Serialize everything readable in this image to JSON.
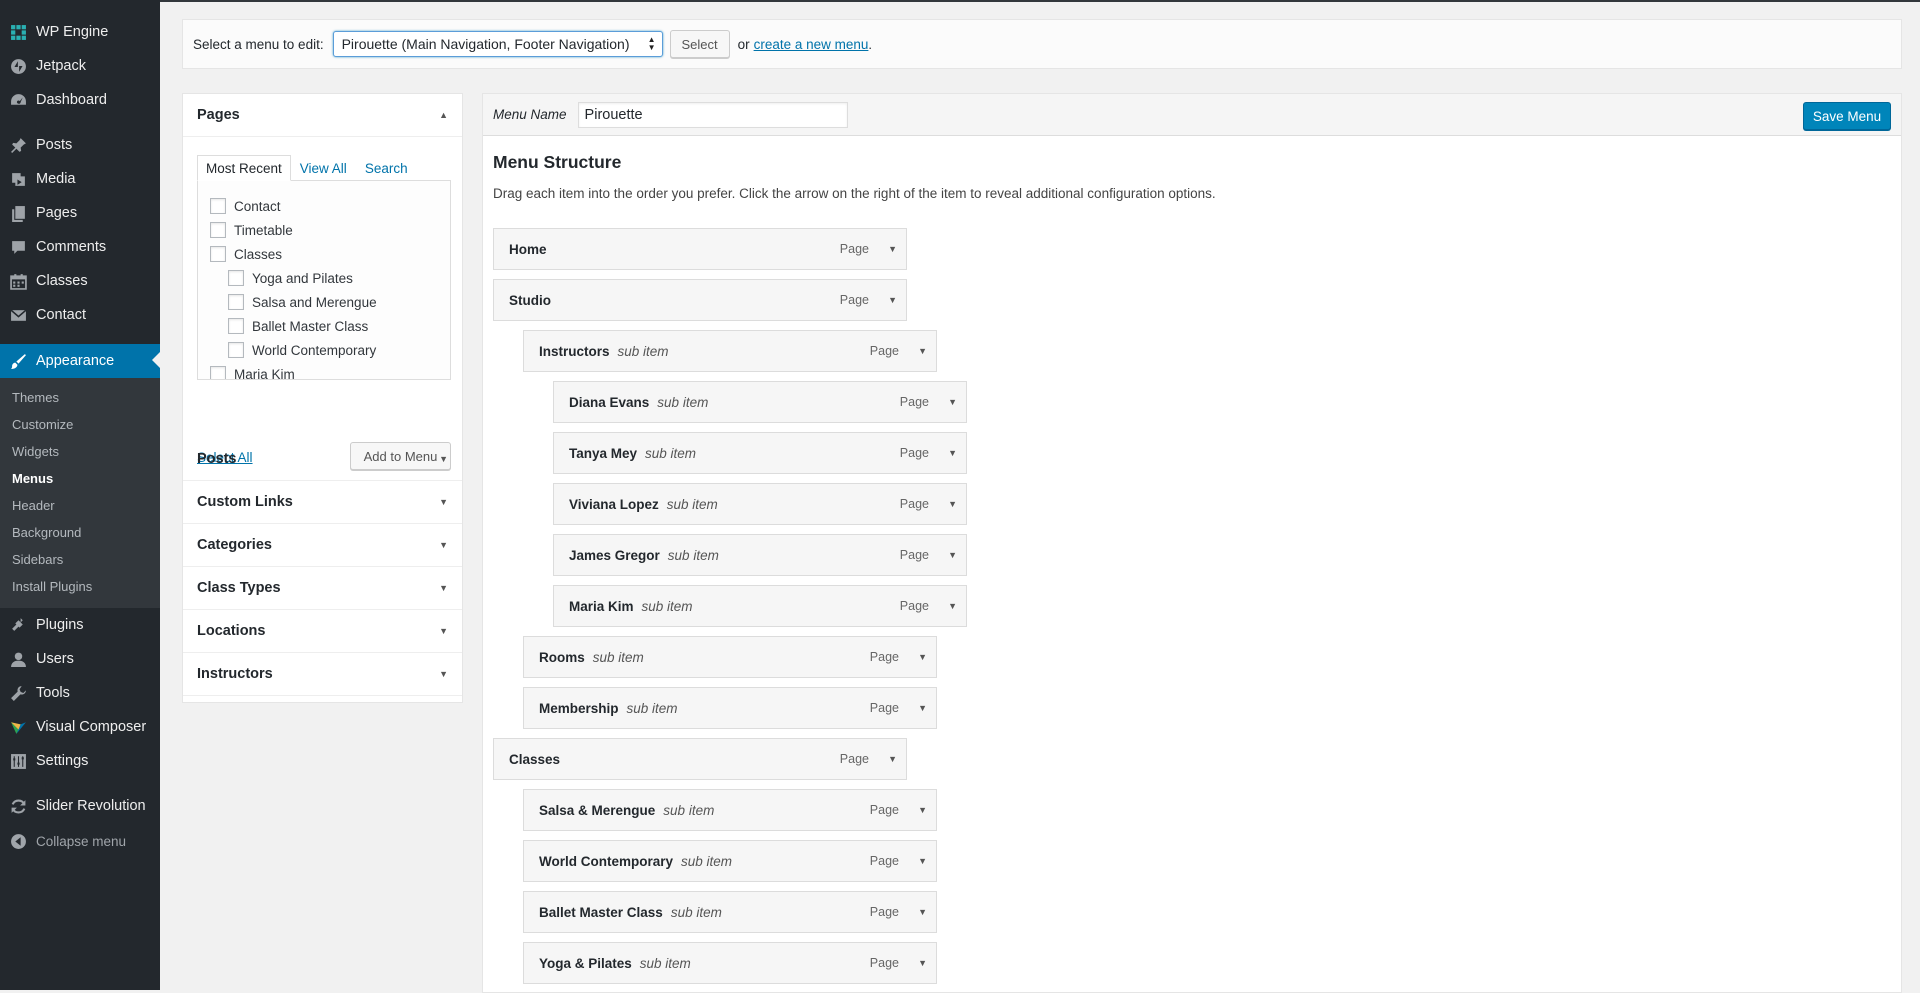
{
  "sidebar": {
    "items": [
      {
        "label": "WP Engine",
        "icon": "wp-engine-icon"
      },
      {
        "label": "Jetpack",
        "icon": "jetpack-icon"
      },
      {
        "label": "Dashboard",
        "icon": "dashboard-icon"
      },
      {
        "label": "Posts",
        "icon": "pin-icon"
      },
      {
        "label": "Media",
        "icon": "media-icon"
      },
      {
        "label": "Pages",
        "icon": "pages-icon"
      },
      {
        "label": "Comments",
        "icon": "comments-icon"
      },
      {
        "label": "Classes",
        "icon": "calendar-icon"
      },
      {
        "label": "Contact",
        "icon": "email-icon"
      },
      {
        "label": "Appearance",
        "icon": "paintbrush-icon"
      },
      {
        "label": "Plugins",
        "icon": "plugins-icon"
      },
      {
        "label": "Users",
        "icon": "users-icon"
      },
      {
        "label": "Tools",
        "icon": "tools-icon"
      },
      {
        "label": "Visual Composer",
        "icon": "visual-composer-icon"
      },
      {
        "label": "Settings",
        "icon": "settings-icon"
      },
      {
        "label": "Slider Revolution",
        "icon": "refresh-icon"
      }
    ],
    "appearance_sub": [
      "Themes",
      "Customize",
      "Widgets",
      "Menus",
      "Header",
      "Background",
      "Sidebars",
      "Install Plugins"
    ],
    "collapse_label": "Collapse menu"
  },
  "manage": {
    "label": "Select a menu to edit:",
    "selected_menu": "Pirouette (Main Navigation, Footer Navigation)",
    "select_button": "Select",
    "or_text": "or",
    "create_link": "create a new menu",
    "period": "."
  },
  "pages_box": {
    "title": "Pages",
    "tabs": [
      "Most Recent",
      "View All",
      "Search"
    ],
    "items": [
      {
        "label": "Contact",
        "level": 0
      },
      {
        "label": "Timetable",
        "level": 0
      },
      {
        "label": "Classes",
        "level": 0
      },
      {
        "label": "Yoga and Pilates",
        "level": 1
      },
      {
        "label": "Salsa and Merengue",
        "level": 1
      },
      {
        "label": "Ballet Master Class",
        "level": 1
      },
      {
        "label": "World Contemporary",
        "level": 1
      },
      {
        "label": "Maria Kim",
        "level": 0
      }
    ],
    "select_all": "Select All",
    "add_button": "Add to Menu"
  },
  "accordion": [
    "Posts",
    "Custom Links",
    "Categories",
    "Class Types",
    "Locations",
    "Instructors"
  ],
  "menu": {
    "name_label": "Menu Name",
    "name_value": "Pirouette",
    "save_button": "Save Menu",
    "structure_title": "Menu Structure",
    "structure_desc": "Drag each item into the order you prefer. Click the arrow on the right of the item to reveal additional configuration options.",
    "sub_label": "sub item",
    "items": [
      {
        "title": "Home",
        "depth": 0,
        "type": "Page"
      },
      {
        "title": "Studio",
        "depth": 0,
        "type": "Page"
      },
      {
        "title": "Instructors",
        "depth": 1,
        "type": "Page"
      },
      {
        "title": "Diana Evans",
        "depth": 2,
        "type": "Page"
      },
      {
        "title": "Tanya Mey",
        "depth": 2,
        "type": "Page"
      },
      {
        "title": "Viviana Lopez",
        "depth": 2,
        "type": "Page"
      },
      {
        "title": "James Gregor",
        "depth": 2,
        "type": "Page"
      },
      {
        "title": "Maria Kim",
        "depth": 2,
        "type": "Page"
      },
      {
        "title": "Rooms",
        "depth": 1,
        "type": "Page"
      },
      {
        "title": "Membership",
        "depth": 1,
        "type": "Page"
      },
      {
        "title": "Classes",
        "depth": 0,
        "type": "Page"
      },
      {
        "title": "Salsa & Merengue",
        "depth": 1,
        "type": "Page"
      },
      {
        "title": "World Contemporary",
        "depth": 1,
        "type": "Page"
      },
      {
        "title": "Ballet Master Class",
        "depth": 1,
        "type": "Page"
      },
      {
        "title": "Yoga & Pilates",
        "depth": 1,
        "type": "Page"
      }
    ]
  },
  "colors": {
    "sidebar_bg": "#23282d",
    "accent": "#0073aa",
    "button_primary": "#0085ba"
  }
}
